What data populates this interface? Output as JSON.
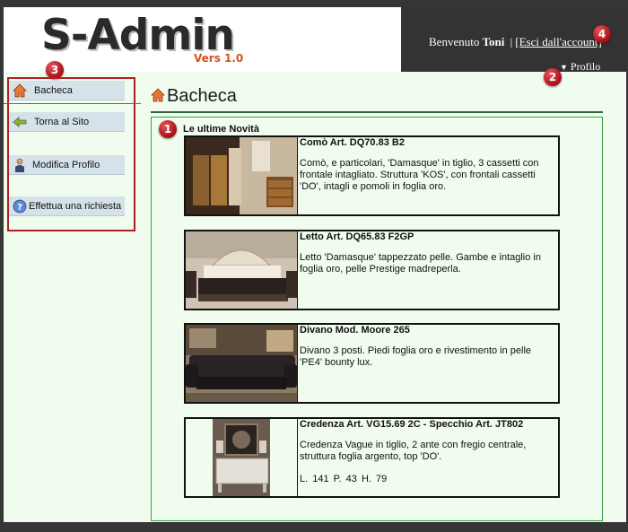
{
  "app": {
    "logo_text": "S-Admin",
    "logo_version": "Vers 1.0"
  },
  "header": {
    "welcome_prefix": "Benvenuto",
    "user_name": "Toni",
    "separator": "|",
    "logout_label": "[Esci dall'account]",
    "profile_label": "Profilo"
  },
  "badges": [
    "1",
    "2",
    "3",
    "4"
  ],
  "sidebar": {
    "items": [
      {
        "label": "Bacheca",
        "icon": "home-icon"
      },
      {
        "label": "Torna al Sito",
        "icon": "arrow-left-icon"
      },
      {
        "label": "Modifica Profilo",
        "icon": "user-icon"
      },
      {
        "label": "Effettua una richiesta",
        "icon": "help-icon"
      }
    ]
  },
  "main": {
    "page_title": "Bacheca",
    "section_title": "Le ultime Novità",
    "products": [
      {
        "name": "Comò Art. DQ70.83 B2",
        "description": "Comò, e particolari, 'Damasque' in tiglio, 3 cassetti con frontale intagliato. Struttura 'KOS', con frontali cassetti 'DO', intagli e pomoli in foglia oro.",
        "dimensions": ""
      },
      {
        "name": "Letto Art. DQ65.83 F2GP",
        "description": "Letto 'Damasque' tappezzato pelle. Gambe e intaglio in foglia oro, pelle Prestige madreperla.",
        "dimensions": ""
      },
      {
        "name": "Divano Mod. Moore 265",
        "description": "Divano 3 posti. Piedi foglia oro e rivestimento in pelle 'PE4' bounty lux.",
        "dimensions": ""
      },
      {
        "name": "Credenza Art. VG15.69 2C - Specchio Art. JT802",
        "description": "Credenza Vague in tiglio, 2 ante con fregio centrale, struttura foglia argento, top 'DO'.",
        "dimensions": "L. 141  P. 43  H. 79"
      }
    ]
  },
  "colors": {
    "background": "#f0fced",
    "header_dark": "#333333",
    "accent_red": "#b01e1e",
    "panel_border": "#3aa04a",
    "logo_version": "#d2531d"
  }
}
